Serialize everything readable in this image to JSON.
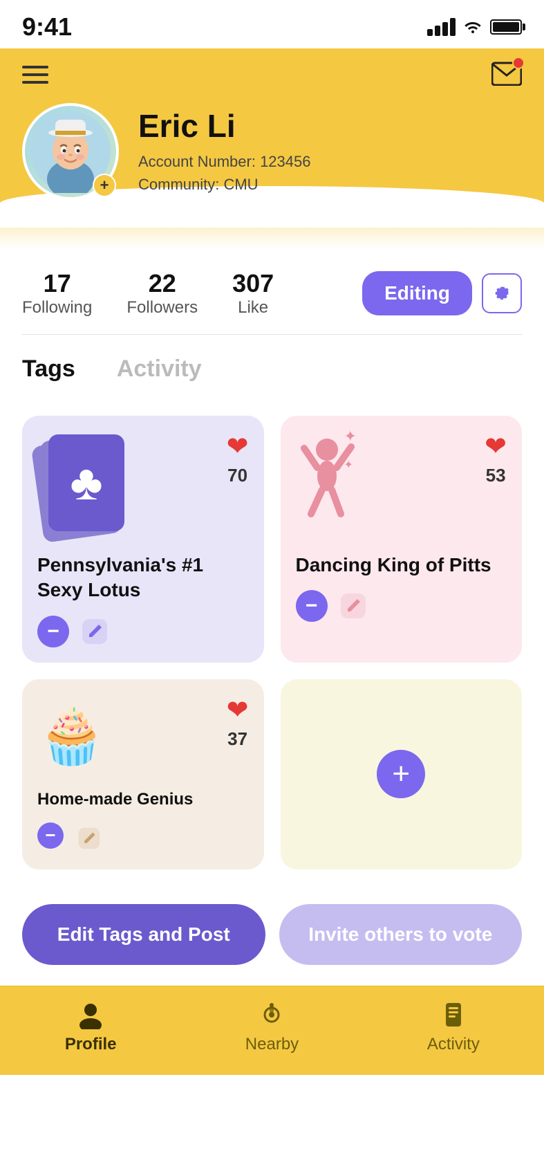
{
  "statusBar": {
    "time": "9:41"
  },
  "header": {
    "mailLabel": "mail"
  },
  "profile": {
    "name": "Eric Li",
    "accountNumber": "Account Number: 123456",
    "community": "Community: CMU"
  },
  "stats": {
    "following": "17",
    "followingLabel": "Following",
    "followers": "22",
    "followersLabel": "Followers",
    "likes": "307",
    "likesLabel": "Like"
  },
  "buttons": {
    "editing": "Editing",
    "editTags": "Edit Tags and Post",
    "invite": "Invite others to vote"
  },
  "tabs": {
    "tags": "Tags",
    "activity": "Activity"
  },
  "cards": [
    {
      "id": "card1",
      "title": "Pennsylvania's #1 Sexy Lotus",
      "likes": "70",
      "color": "purple"
    },
    {
      "id": "card2",
      "title": "Dancing King of Pitts",
      "likes": "53",
      "color": "pink"
    },
    {
      "id": "card3",
      "title": "Home-made Genius",
      "likes": "37",
      "color": "beige"
    }
  ],
  "bottomNav": [
    {
      "id": "profile",
      "label": "Profile",
      "active": true
    },
    {
      "id": "nearby",
      "label": "Nearby",
      "active": false
    },
    {
      "id": "activity",
      "label": "Activity",
      "active": false
    }
  ]
}
